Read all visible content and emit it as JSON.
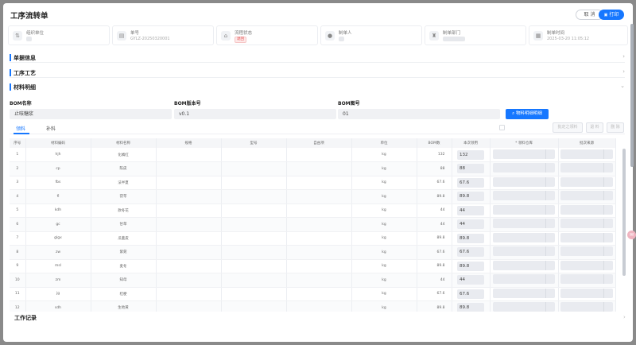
{
  "header": {
    "title": "工序流转单",
    "cancel_label": "取 消",
    "print_label": "打印"
  },
  "info": [
    {
      "icon": "org-icon",
      "glyph": "⇅",
      "label": "组织单位",
      "value": ""
    },
    {
      "icon": "doc-icon",
      "glyph": "▤",
      "label": "单号",
      "value": "GYLZ-20250320001"
    },
    {
      "icon": "flow-icon",
      "glyph": "⌂",
      "label": "流程状态",
      "value": "退回"
    },
    {
      "icon": "user-icon",
      "glyph": "●",
      "label": "制单人",
      "value": ""
    },
    {
      "icon": "dept-icon",
      "glyph": "♜",
      "label": "制单部门",
      "value": ""
    },
    {
      "icon": "calendar-icon",
      "glyph": "▦",
      "label": "制单时间",
      "value": "2025-03-20 11:05:12"
    }
  ],
  "sections": {
    "doc_info": "单据信息",
    "process": "工序工艺",
    "materials": "材料明细",
    "next": "工作记录"
  },
  "bom": {
    "name_label": "BOM名称",
    "name_value": "止咳糖浆",
    "version_label": "BOM版本号",
    "version_value": "v0.1",
    "drawing_label": "BOM图号",
    "drawing_value": "01",
    "select_btn": "物料明细明细"
  },
  "tabs": {
    "tab1": "领料",
    "tab2": "补料"
  },
  "table_buttons": {
    "b1": "批定之领料",
    "b2": "退 料",
    "b3": "删 除"
  },
  "columns": [
    "序号",
    "材料编码",
    "材料名称",
    "规格",
    "型号",
    "自由项",
    "单位",
    "BOM数",
    "本次领用",
    "* 领料仓库",
    "批次来源"
  ],
  "rows": [
    {
      "no": "1",
      "code": "hjh",
      "name": "化橘红",
      "unit": "kg",
      "bom": "132",
      "qty": "132"
    },
    {
      "no": "2",
      "code": "cp",
      "name": "陈皮",
      "unit": "kg",
      "bom": "88",
      "qty": "88"
    },
    {
      "no": "3",
      "code": "fbs",
      "name": "法半夏",
      "unit": "kg",
      "bom": "67.6",
      "qty": "67.6"
    },
    {
      "no": "4",
      "code": "fl",
      "name": "茯苓",
      "unit": "kg",
      "bom": "89.8",
      "qty": "89.8"
    },
    {
      "no": "5",
      "code": "kdh",
      "name": "款冬花",
      "unit": "kg",
      "bom": "44",
      "qty": "44"
    },
    {
      "no": "6",
      "code": "gc",
      "name": "甘草",
      "unit": "kg",
      "bom": "44",
      "qty": "44"
    },
    {
      "no": "7",
      "code": "glgx",
      "name": "瓜蒌皮",
      "unit": "kg",
      "bom": "89.8",
      "qty": "89.8"
    },
    {
      "no": "8",
      "code": "zw",
      "name": "紫菀",
      "unit": "kg",
      "bom": "67.6",
      "qty": "67.6"
    },
    {
      "no": "9",
      "code": "msl",
      "name": "麦冬",
      "unit": "kg",
      "bom": "89.8",
      "qty": "89.8"
    },
    {
      "no": "10",
      "code": "zm",
      "name": "知母",
      "unit": "kg",
      "bom": "44",
      "qty": "44"
    },
    {
      "no": "11",
      "code": "jg",
      "name": "桔梗",
      "unit": "kg",
      "bom": "67.6",
      "qty": "67.6"
    },
    {
      "no": "12",
      "code": "sdh",
      "name": "生地黄",
      "unit": "kg",
      "bom": "89.8",
      "qty": "89.8"
    }
  ]
}
